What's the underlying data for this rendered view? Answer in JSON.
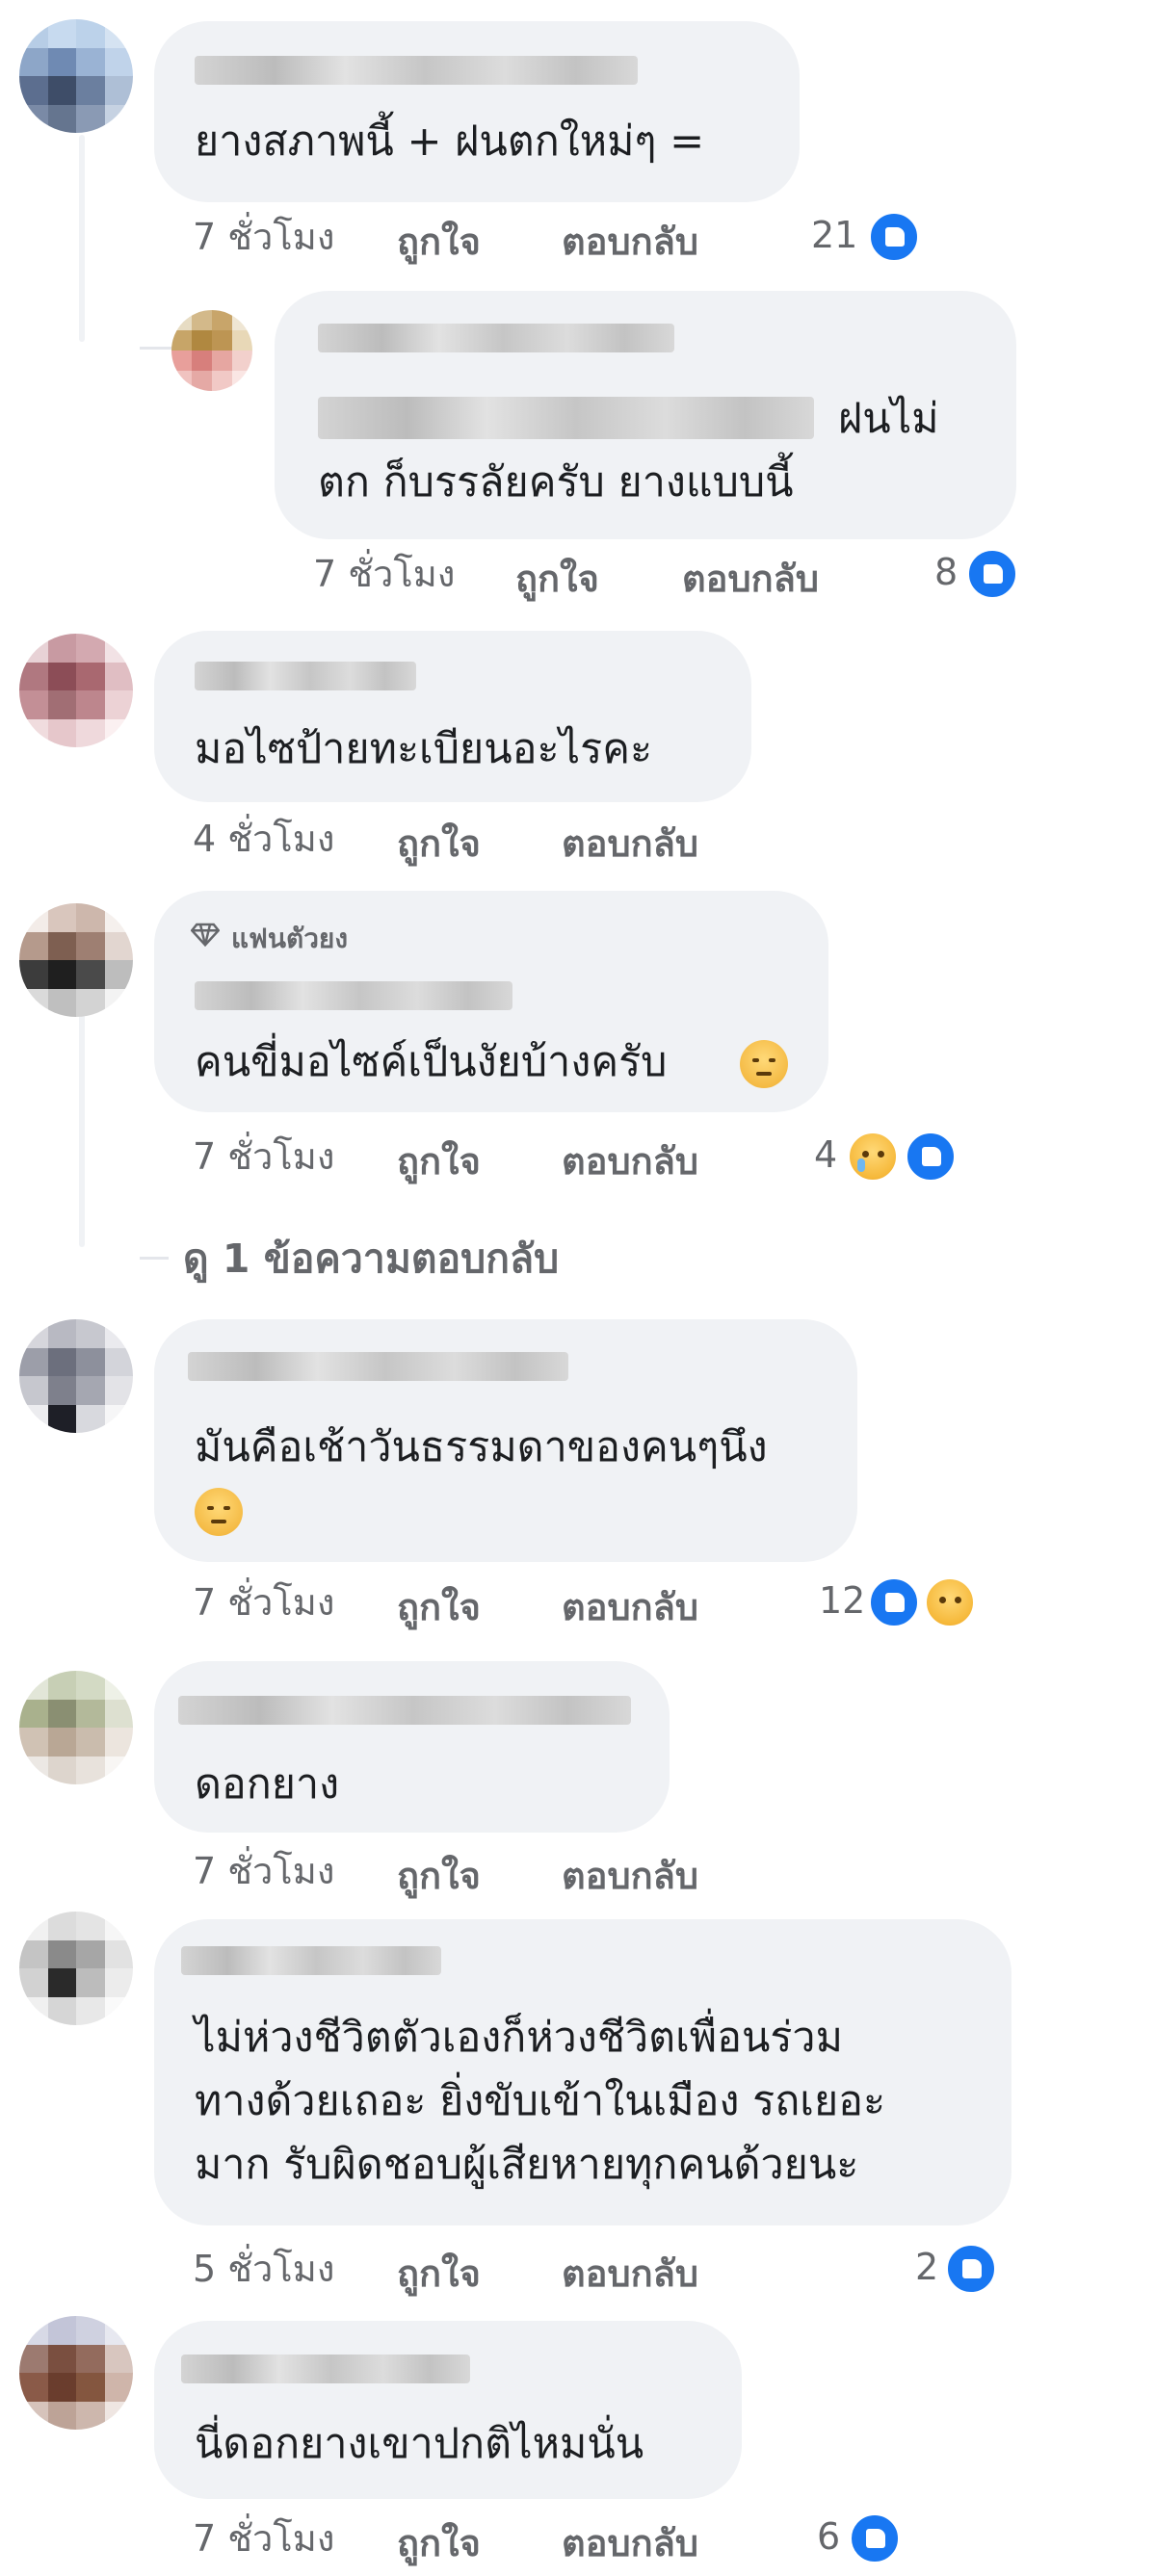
{
  "labels": {
    "like": "ถูกใจ",
    "reply": "ตอบกลับ"
  },
  "comments": [
    {
      "text": "ยางสภาพนี้ + ฝนตกใหม่ๆ =",
      "time": "7 ชั่วโมง",
      "reactions": "21"
    },
    {
      "text": "ฝนไม่\nตก ก็บรรลัยครับ ยางแบบนี้",
      "time": "7 ชั่วโมง",
      "reactions": "8"
    },
    {
      "text": "มอไซป้ายทะเบียนอะไรคะ",
      "time": "4 ชั่วโมง",
      "reactions": ""
    },
    {
      "badge": "แฟนตัวยง",
      "text": "คนขี่มอไซค์เป็นงัยบ้างครับ",
      "time": "7 ชั่วโมง",
      "reactions": "4"
    },
    {
      "text": "มันคือเช้าวันธรรมดาของคนๆนึง",
      "time": "7 ชั่วโมง",
      "reactions": "12"
    },
    {
      "text": "ดอกยาง",
      "time": "7 ชั่วโมง",
      "reactions": ""
    },
    {
      "text": "ไม่ห่วงชีวิตตัวเองก็ห่วงชีวิตเพื่อนร่วม\nทางด้วยเถอะ ยิ่งขับเข้าในเมือง รถเยอะ\nมาก รับผิดชอบผู้เสียหายทุกคนด้วยนะ",
      "time": "5 ชั่วโมง",
      "reactions": "2"
    },
    {
      "text": "นี่ดอกยางเขาปกติไหมนั่น",
      "time": "7 ชั่วโมง",
      "reactions": "6"
    }
  ],
  "view_replies": "ดู 1 ข้อความตอบกลับ",
  "icons": {
    "like": "like-icon",
    "cry": "cry-icon",
    "sad": "sad-icon",
    "diamond": "diamond-icon",
    "emoji": "sad-face-emoji"
  },
  "colors": {
    "bubble": "#f0f2f5",
    "like_blue": "#1877f2",
    "meta_gray": "#65676b"
  }
}
